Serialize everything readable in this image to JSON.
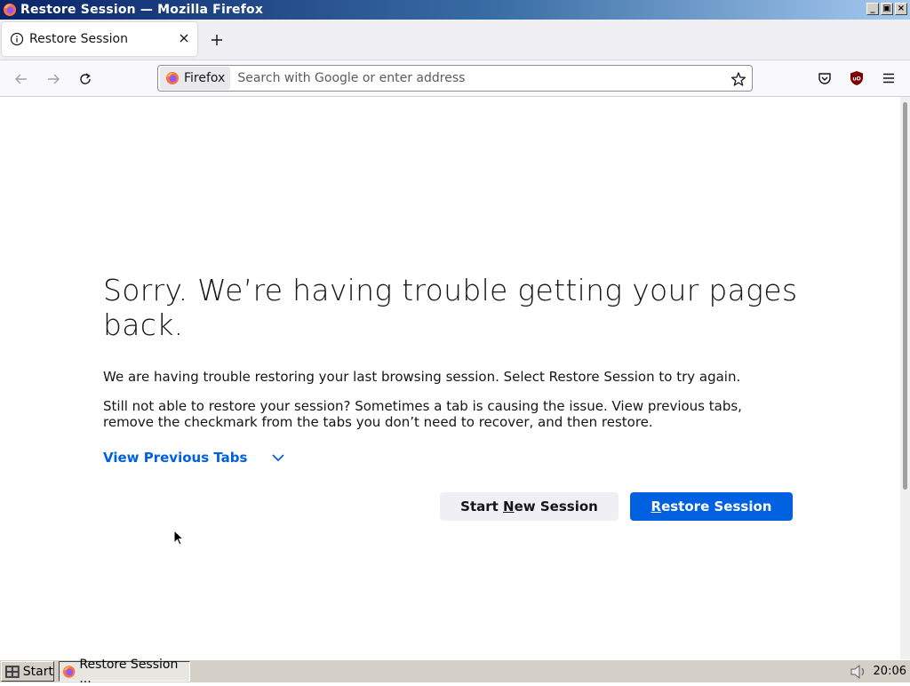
{
  "window": {
    "title": "Restore Session — Mozilla Firefox"
  },
  "tabs": [
    {
      "label": "Restore Session"
    }
  ],
  "urlbar": {
    "identity_label": "Firefox",
    "placeholder": "Search with Google or enter address",
    "value": ""
  },
  "page": {
    "headline": "Sorry. We’re having trouble getting your pages back.",
    "paragraph1": "We are having trouble restoring your last browsing session. Select Restore Session to try again.",
    "paragraph2": "Still not able to restore your session? Sometimes a tab is causing the issue. View previous tabs, remove the checkmark from the tabs you don’t need to recover, and then restore.",
    "view_previous_tabs": "View Previous Tabs",
    "start_new_pre": "Start ",
    "start_new_accel": "N",
    "start_new_post": "ew Session",
    "restore_accel": "R",
    "restore_post": "estore Session"
  },
  "taskbar": {
    "start_label": "Start",
    "task_label": "Restore Session ...",
    "clock": "20:06"
  },
  "colors": {
    "accent": "#0061e0",
    "titlebar_start": "#0a246a",
    "taskbar_bg": "#d4d0c8"
  },
  "icons": [
    "firefox-icon",
    "info-icon",
    "close-icon",
    "plus-icon",
    "back-arrow-icon",
    "forward-arrow-icon",
    "reload-icon",
    "bookmark-star-icon",
    "pocket-icon",
    "ublock-icon",
    "menu-icon",
    "chevron-down-icon",
    "cursor-icon",
    "volume-icon"
  ]
}
